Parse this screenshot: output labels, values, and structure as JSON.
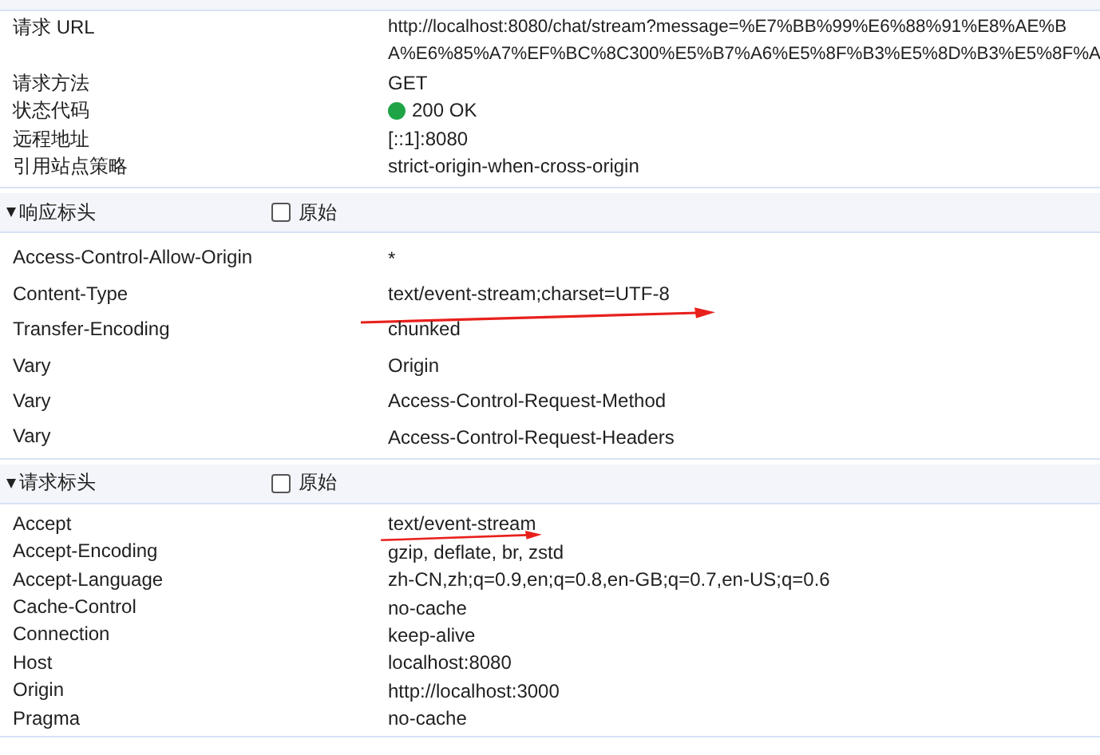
{
  "general": {
    "rows": [
      {
        "kind": "text",
        "name": "请求 URL",
        "value_lines": [
          "http://localhost:8080/chat/stream?message=%E7%BB%99%E6%88%91%E8%AE%B",
          "A%E6%85%A7%EF%BC%8C300%E5%B7%A6%E5%8F%B3%E5%8D%B3%E5%8F%A"
        ]
      },
      {
        "kind": "text",
        "name": "请求方法",
        "value_lines": [
          "GET"
        ]
      },
      {
        "kind": "status",
        "name": "状态代码",
        "value_lines": [
          "200 OK"
        ]
      },
      {
        "kind": "text",
        "name": "远程地址",
        "value_lines": [
          "[::1]:8080"
        ]
      },
      {
        "kind": "text",
        "name": "引用站点策略",
        "value_lines": [
          "strict-origin-when-cross-origin"
        ]
      }
    ]
  },
  "sections": [
    {
      "title": "响应标头",
      "expanded": true,
      "raw": {
        "label": "原始",
        "checked": false
      },
      "rows": [
        {
          "name": "Access-Control-Allow-Origin",
          "value": "*",
          "annotated": false
        },
        {
          "name": "Content-Type",
          "value": "text/event-stream;charset=UTF-8",
          "annotated": true
        },
        {
          "name": "Transfer-Encoding",
          "value": "chunked",
          "annotated": false
        },
        {
          "name": "Vary",
          "value": "Origin",
          "annotated": false
        },
        {
          "name": "Vary",
          "value": "Access-Control-Request-Method",
          "annotated": false
        },
        {
          "name": "Vary",
          "value": "Access-Control-Request-Headers",
          "annotated": false
        }
      ]
    },
    {
      "title": "请求标头",
      "expanded": true,
      "raw": {
        "label": "原始",
        "checked": false
      },
      "rows": [
        {
          "name": "Accept",
          "value": "text/event-stream",
          "annotated": true
        },
        {
          "name": "Accept-Encoding",
          "value": "gzip, deflate, br, zstd",
          "annotated": false
        },
        {
          "name": "Accept-Language",
          "value": "zh-CN,zh;q=0.9,en;q=0.8,en-GB;q=0.7,en-US;q=0.6",
          "annotated": false
        },
        {
          "name": "Cache-Control",
          "value": "no-cache",
          "annotated": false
        },
        {
          "name": "Connection",
          "value": "keep-alive",
          "annotated": false
        },
        {
          "name": "Host",
          "value": "localhost:8080",
          "annotated": false
        },
        {
          "name": "Origin",
          "value": "http://localhost:3000",
          "annotated": false
        },
        {
          "name": "Pragma",
          "value": "no-cache",
          "annotated": false
        }
      ]
    }
  ]
}
